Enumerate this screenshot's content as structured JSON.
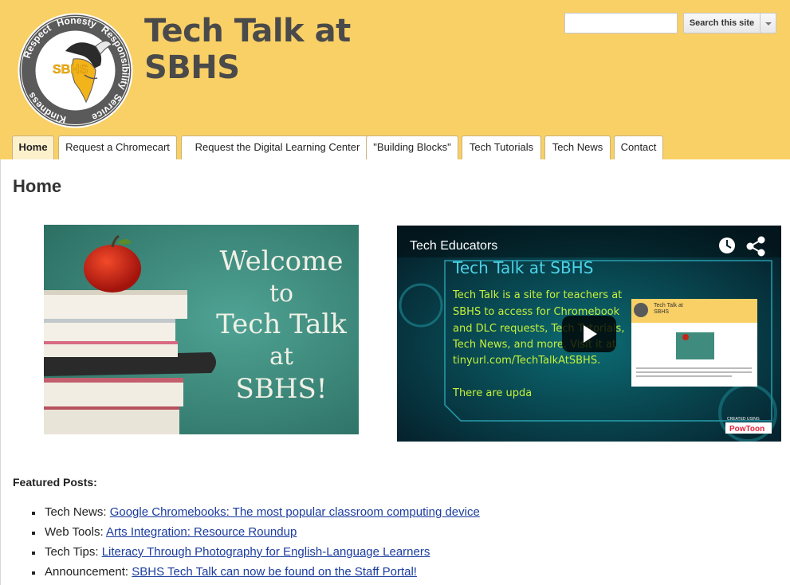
{
  "site": {
    "title_line1": "Tech Talk at",
    "title_line2": "SBHS",
    "logo": {
      "words": [
        "Honesty",
        "Responsibility",
        "Service",
        "Kindness",
        "Respect"
      ],
      "center_text": "SBHS"
    }
  },
  "search": {
    "placeholder": "",
    "button_label": "Search this site"
  },
  "nav": {
    "tabs": [
      {
        "label": "Home",
        "active": true
      },
      {
        "label": "Request a Chromecart",
        "active": false
      },
      {
        "label": "Request the Digital Learning Center",
        "active": false
      },
      {
        "label": "\"Building Blocks\"",
        "active": false
      },
      {
        "label": "Tech Tutorials",
        "active": false
      },
      {
        "label": "Tech News",
        "active": false
      },
      {
        "label": "Contact",
        "active": false
      }
    ]
  },
  "page": {
    "title": "Home"
  },
  "welcome_image": {
    "lines": [
      "Welcome",
      "to",
      "Tech Talk",
      "at",
      "SBHS!"
    ]
  },
  "video": {
    "channel": "Tech Educators",
    "heading": "Tech Talk at SBHS",
    "body_lines": [
      "Tech Talk is a site for teachers at",
      "SBHS to access for Chromebook",
      "and DLC requests, Tech Tutorials,",
      "Tech News, and more. Visit it at",
      "tinyurl.com/TechTalkAtSBHS."
    ],
    "footer_line": "There are upda",
    "thumb_title": "Tech Talk at",
    "thumb_subtitle": "SBHS",
    "brand": "PowToon",
    "brand_small": "CREATED USING"
  },
  "featured": {
    "heading": "Featured Posts:",
    "posts": [
      {
        "category": "Tech News:",
        "link": "Google Chromebooks: The most popular classroom computing device"
      },
      {
        "category": "Web Tools:",
        "link": "Arts Integration: Resource Roundup"
      },
      {
        "category": "Tech Tips:",
        "link": "Literacy Through Photography for English-Language Learners"
      },
      {
        "category": "Announcement:",
        "link": "SBHS Tech Talk can now be found on the Staff Portal!"
      }
    ]
  },
  "colors": {
    "header_bg": "#f9d066",
    "link": "#1a3c9e",
    "chalkboard": "#3f8c7e",
    "video_text": "#c5f03a",
    "video_heading": "#4cd3e8"
  }
}
